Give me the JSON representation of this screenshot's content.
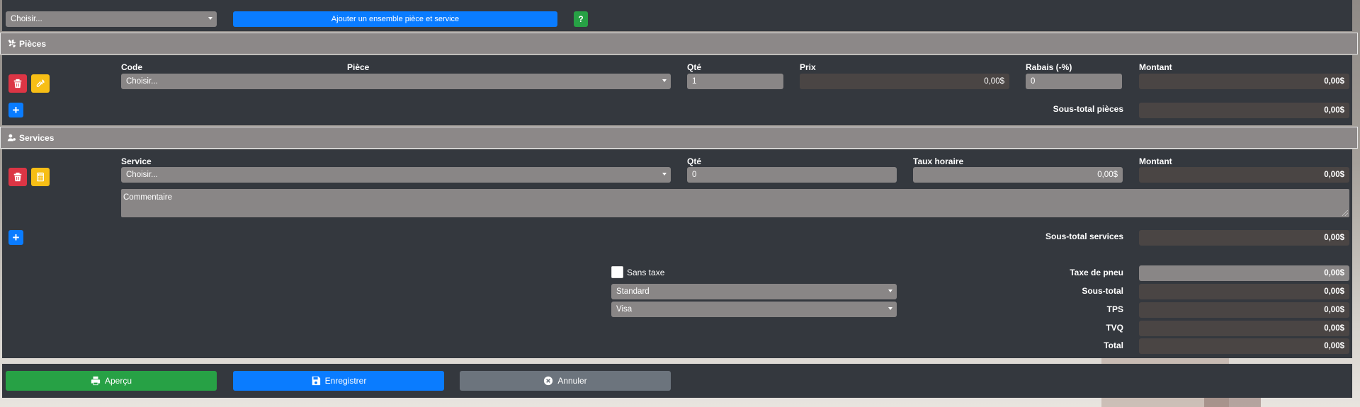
{
  "top": {
    "select_value": "Choisir...",
    "add_set_label": "Ajouter un ensemble pièce et service",
    "help_label": "?"
  },
  "pieces": {
    "header": "Pièces",
    "col_code": "Code",
    "col_piece": "Pièce",
    "col_qty": "Qté",
    "col_price": "Prix",
    "col_discount": "Rabais (-%)",
    "col_amount": "Montant",
    "row": {
      "select": "Choisir...",
      "qty": "1",
      "price": "0,00$",
      "discount": "0",
      "amount": "0,00$"
    },
    "subtotal_label": "Sous-total pièces",
    "subtotal_value": "0,00$"
  },
  "services": {
    "header": "Services",
    "col_service": "Service",
    "col_qty": "Qté",
    "col_rate": "Taux horaire",
    "col_amount": "Montant",
    "row": {
      "select": "Choisir...",
      "qty": "0",
      "rate": "0,00$",
      "amount": "0,00$",
      "comment_placeholder": "Commentaire"
    },
    "subtotal_label": "Sous-total services",
    "subtotal_value": "0,00$"
  },
  "totals": {
    "no_tax_label": "Sans taxe",
    "tax_type": "Standard",
    "payment_method": "Visa",
    "tire_tax_label": "Taxe de pneu",
    "tire_tax_value": "0,00$",
    "subtotal_label": "Sous-total",
    "subtotal_value": "0,00$",
    "tps_label": "TPS",
    "tps_value": "0,00$",
    "tvq_label": "TVQ",
    "tvq_value": "0,00$",
    "total_label": "Total",
    "total_value": "0,00$"
  },
  "footer": {
    "preview_label": "Aperçu",
    "save_label": "Enregistrer",
    "cancel_label": "Annuler"
  },
  "colors": {
    "panel": "#34383e",
    "header": "#8c8888",
    "primary": "#0a7cff",
    "success": "#27a145",
    "danger": "#dc3545",
    "warning": "#f7be15",
    "secondary": "#6c747d"
  }
}
